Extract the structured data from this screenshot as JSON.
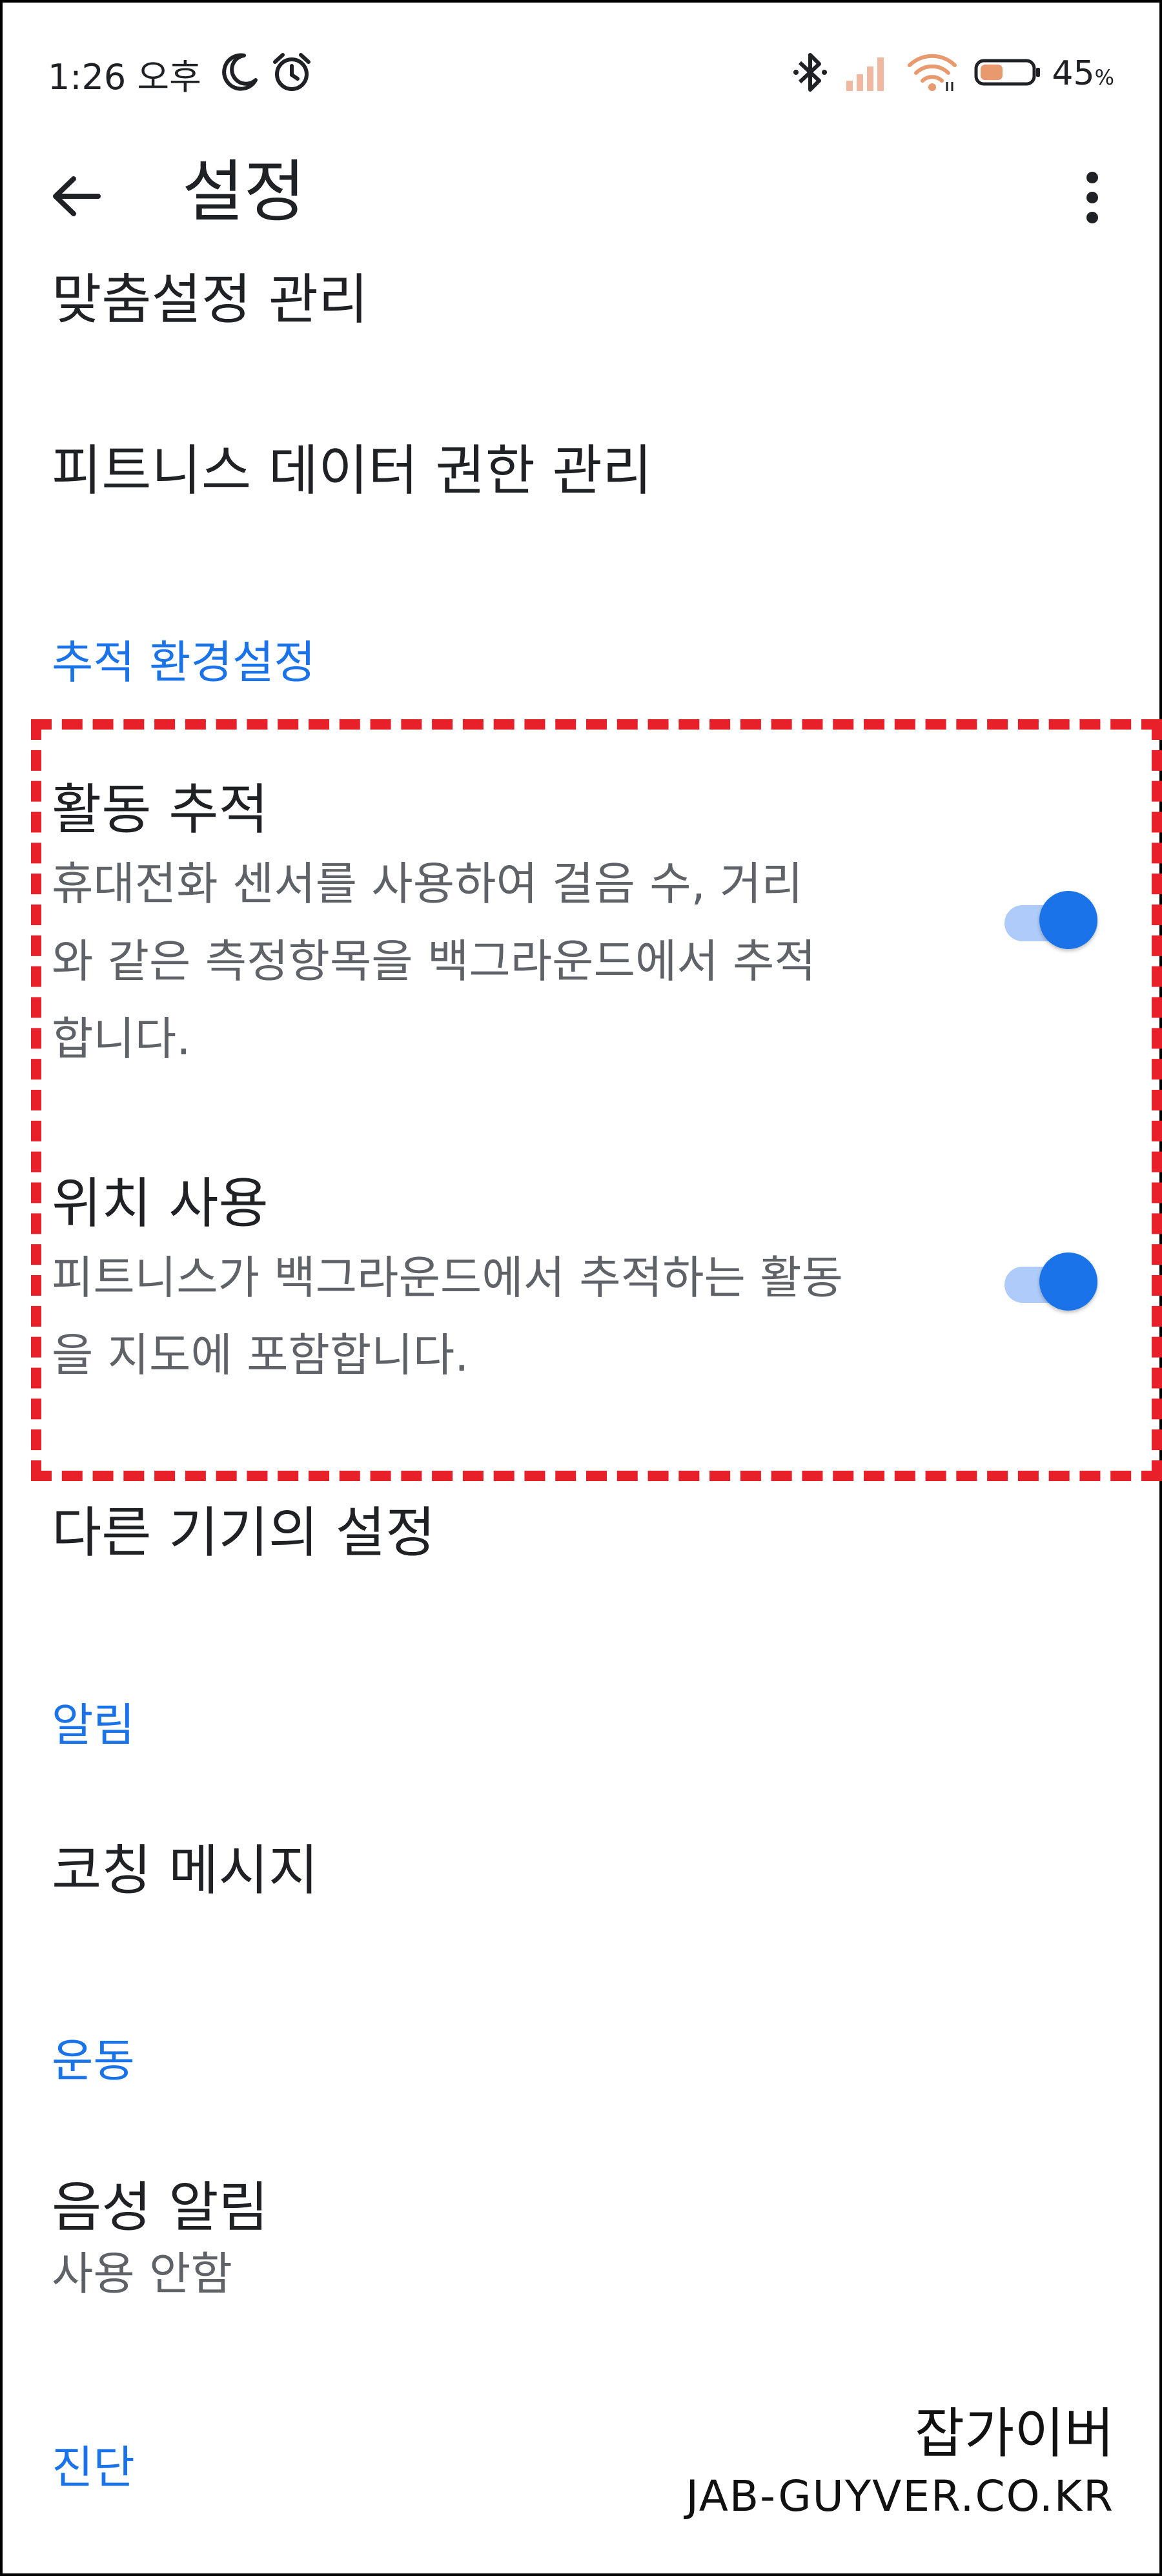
{
  "status_bar": {
    "time": "1:26 오후",
    "battery_percent": "45",
    "battery_unit": "%",
    "battery_level": 0.45,
    "icons": [
      "moon-icon",
      "alarm-icon",
      "bluetooth-icon",
      "cell-signal-icon",
      "wifi-icon",
      "battery-icon"
    ]
  },
  "app_bar": {
    "title": "설정",
    "back_icon": "arrow-back-icon",
    "more_icon": "more-vert-icon"
  },
  "list": {
    "manage_personalization": "맞춤설정 관리",
    "fitness_data_permissions": "피트니스 데이터 권한 관리",
    "tracking_section": "추적 환경설정",
    "activity_tracking": {
      "title": "활동 추적",
      "summary_lines": [
        "휴대전화 센서를 사용하여 걸음 수, 거리",
        "와 같은 측정항목을 백그라운드에서 추적",
        "합니다."
      ],
      "enabled": true
    },
    "location_use": {
      "title": "위치 사용",
      "summary_lines": [
        "피트니스가 백그라운드에서 추적하는 활동",
        "을 지도에 포함합니다."
      ],
      "enabled": true
    },
    "other_devices": "다른 기기의 설정",
    "alerts_section": "알림",
    "coaching_messages": "코칭 메시지",
    "workout_section": "운동",
    "voice_alerts": {
      "title": "음성 알림",
      "summary": "사용 안함"
    },
    "diagnostics_section": "진단"
  },
  "watermark": {
    "korean": "잡가이버",
    "domain": "JAB-GUYVER.CO.KR"
  },
  "colors": {
    "accent": "#1a73e8",
    "toggle_track": "#aecbfa",
    "highlight": "#e8202a",
    "text_primary": "#202124",
    "text_secondary": "#5f6368"
  }
}
